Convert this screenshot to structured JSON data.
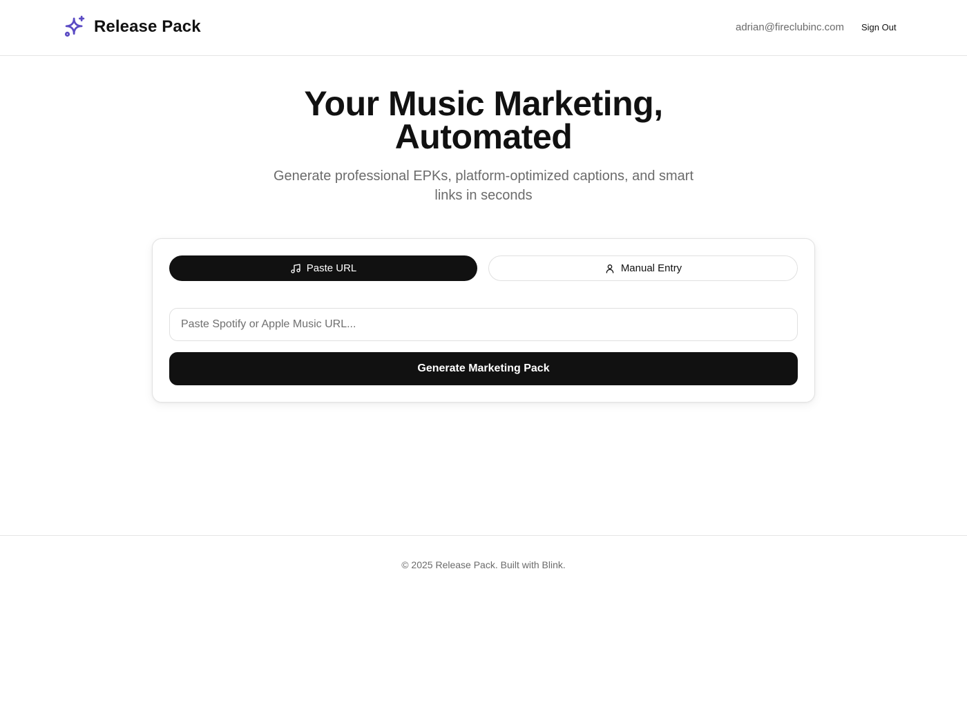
{
  "header": {
    "brand_name": "Release Pack",
    "brand_icon": "sparkles-icon",
    "brand_color": "#5B4BC4",
    "user_email": "adrian@fireclubinc.com",
    "sign_out_label": "Sign Out"
  },
  "hero": {
    "title_lines": [
      "Your Music Marketing,",
      "Automated"
    ],
    "subtitle_lines": [
      "Generate professional EPKs, platform-optimized captions, and smart",
      "links in seconds"
    ]
  },
  "form": {
    "tabs": [
      {
        "label": "Paste URL",
        "icon": "music-note-icon",
        "active": true
      },
      {
        "label": "Manual Entry",
        "icon": "user-icon",
        "active": false
      }
    ],
    "url_input": {
      "value": "",
      "placeholder": "Paste Spotify or Apple Music URL..."
    },
    "submit_label": "Generate Marketing Pack"
  },
  "footer": {
    "text": "© 2025 Release Pack. Built with Blink."
  }
}
